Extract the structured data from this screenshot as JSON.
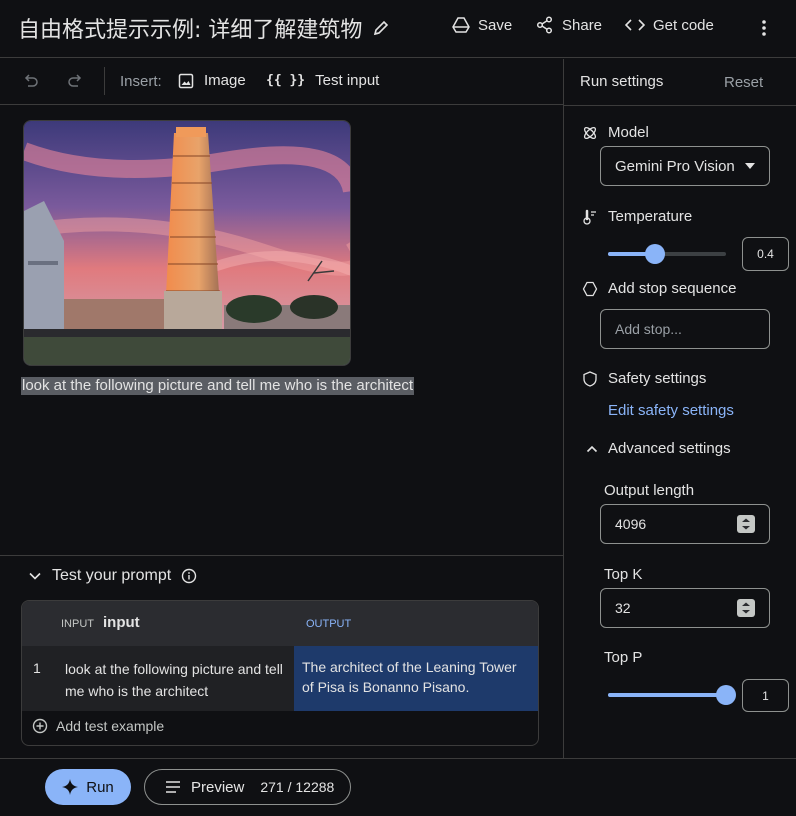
{
  "header": {
    "title": "自由格式提示示例: 详细了解建筑物",
    "save_label": "Save",
    "share_label": "Share",
    "code_label": "Get code"
  },
  "toolbar": {
    "insert_label": "Insert:",
    "image_label": "Image",
    "test_input_icon": "{{ }}",
    "test_input_label": "Test input"
  },
  "prompt": {
    "image_icon": "leaning-tower-of-pisa-photo",
    "text": "look at the following picture and tell me who is the architect"
  },
  "test_section": {
    "title": "Test your prompt",
    "columns": {
      "input_small": "INPUT",
      "input_name": "input",
      "output": "OUTPUT"
    },
    "rows": [
      {
        "num": "1",
        "input": "look at the following picture and tell me who is the architect",
        "output": "The architect of the Leaning Tower of Pisa is Bonanno Pisano."
      }
    ],
    "add_label": "Add test example"
  },
  "bottom": {
    "run_label": "Run",
    "preview_label": "Preview",
    "token_count": "271 / 12288"
  },
  "run_settings": {
    "title": "Run settings",
    "reset_label": "Reset",
    "model_label": "Model",
    "model_value": "Gemini Pro Vision",
    "temperature_label": "Temperature",
    "temperature_value": "0.4",
    "temperature_fraction": 0.4,
    "stop_label": "Add stop sequence",
    "stop_placeholder": "Add stop...",
    "safety_label": "Safety settings",
    "safety_link": "Edit safety settings",
    "advanced_label": "Advanced settings",
    "output_length_label": "Output length",
    "output_length_value": "4096",
    "top_k_label": "Top K",
    "top_k_value": "32",
    "top_p_label": "Top P",
    "top_p_value": "1",
    "top_p_fraction": 1.0
  },
  "colors": {
    "accent": "#8ab4f8",
    "background": "#0f1013",
    "output_highlight": "#1e3a6b"
  }
}
